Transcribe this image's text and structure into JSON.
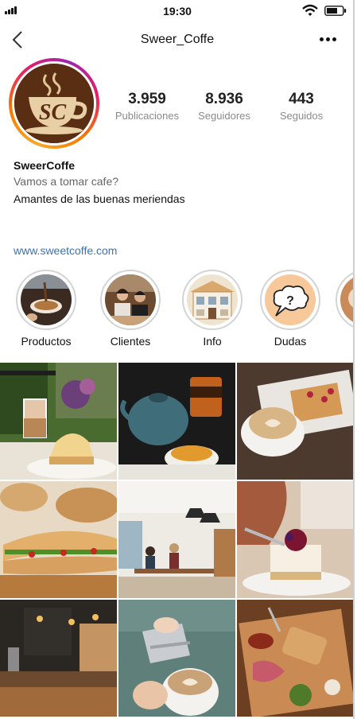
{
  "status_bar": {
    "time": "19:30"
  },
  "header": {
    "username": "Sweer_Coffe"
  },
  "profile": {
    "avatar_text": "SC",
    "stats": [
      {
        "value": "3.959",
        "label": "Publicaciones"
      },
      {
        "value": "8.936",
        "label": "Seguidores"
      },
      {
        "value": "443",
        "label": "Seguidos"
      }
    ],
    "display_name": "SweerCoffe",
    "bio_line1": "Vamos a tomar cafe?",
    "bio_line2": "Amantes de las buenas meriendas",
    "website": "www.sweetcoffe.com"
  },
  "highlights": [
    {
      "label": "Productos"
    },
    {
      "label": "Clientes"
    },
    {
      "label": "Info"
    },
    {
      "label": "Dudas"
    }
  ],
  "posts": [
    {
      "subject": "cake-and-latte-photo"
    },
    {
      "subject": "teapot-and-tea-photo"
    },
    {
      "subject": "cappuccino-and-waffle-photo"
    },
    {
      "subject": "sandwich-photo"
    },
    {
      "subject": "cafe-interior-photo"
    },
    {
      "subject": "cheesecake-photo"
    },
    {
      "subject": "coffee-bar-photo"
    },
    {
      "subject": "latte-art-pour-photo"
    },
    {
      "subject": "charcuterie-board-photo"
    }
  ]
}
